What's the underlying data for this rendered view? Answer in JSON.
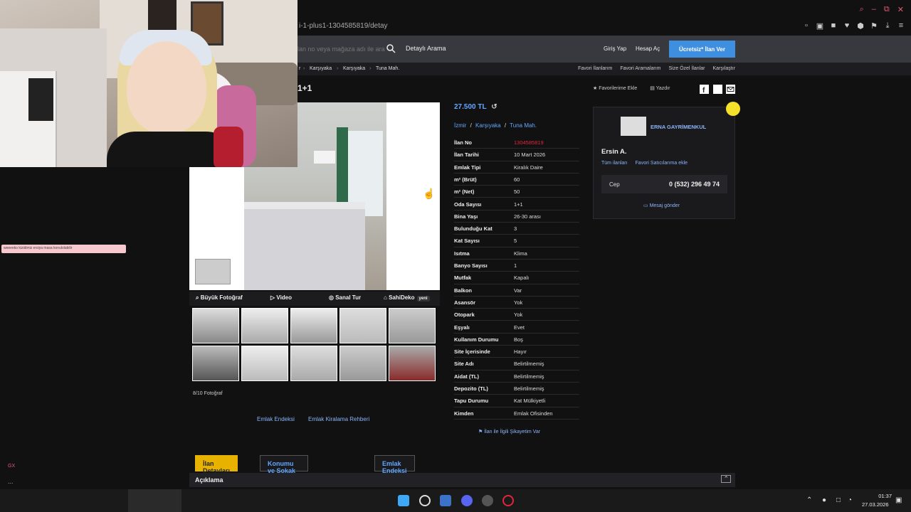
{
  "browser": {
    "url": "i-1-plus1-1304585819/detay",
    "window_controls": [
      "⌕",
      "–",
      "⧉",
      "✕"
    ],
    "toolbar_icons": [
      "▫",
      "▣",
      "■",
      "♥",
      "⬢",
      "⚑",
      "⤓",
      "≡"
    ]
  },
  "site_header": {
    "search_placeholder": "lan no veya mağaza adı ile ara",
    "detailed_search": "Detaylı Arama",
    "login": "Giriş Yap",
    "register": "Hesap Aç",
    "post_ad": "Ücretsiz* İlan Ver"
  },
  "breadcrumb": {
    "items": [
      "r",
      "Karşıyaka",
      "Karşıyaka",
      "Tuna Mah."
    ],
    "links": [
      "Favori İlanlarım",
      "Favori Aramalarım",
      "Size Özel İlanlar",
      "Karşılaştır"
    ]
  },
  "listing": {
    "title": "1+1",
    "favorite": "Favorilerime Ekle",
    "print": "Yazdır",
    "price": "27.500 TL",
    "location": [
      "İzmir",
      "Karşıyaka",
      "Tuna Mah."
    ],
    "location_sep": "/",
    "details": [
      {
        "key": "İlan No",
        "value": "1304585819",
        "highlight": true
      },
      {
        "key": "İlan Tarihi",
        "value": "10 Mart 2026"
      },
      {
        "key": "Emlak Tipi",
        "value": "Kiralık Daire"
      },
      {
        "key": "m² (Brüt)",
        "value": "60"
      },
      {
        "key": "m² (Net)",
        "value": "50"
      },
      {
        "key": "Oda Sayısı",
        "value": "1+1"
      },
      {
        "key": "Bina Yaşı",
        "value": "26-30 arası"
      },
      {
        "key": "Bulunduğu Kat",
        "value": "3"
      },
      {
        "key": "Kat Sayısı",
        "value": "5"
      },
      {
        "key": "Isıtma",
        "value": "Klima"
      },
      {
        "key": "Banyo Sayısı",
        "value": "1"
      },
      {
        "key": "Mutfak",
        "value": "Kapalı"
      },
      {
        "key": "Balkon",
        "value": "Var"
      },
      {
        "key": "Asansör",
        "value": "Yok"
      },
      {
        "key": "Otopark",
        "value": "Yok"
      },
      {
        "key": "Eşyalı",
        "value": "Evet"
      },
      {
        "key": "Kullanım Durumu",
        "value": "Boş"
      },
      {
        "key": "Site İçerisinde",
        "value": "Hayır"
      },
      {
        "key": "Site Adı",
        "value": "Belirtilmemiş"
      },
      {
        "key": "Aidat (TL)",
        "value": "Belirtilmemiş"
      },
      {
        "key": "Depozito (TL)",
        "value": "Belirtilmemiş"
      },
      {
        "key": "Tapu Durumu",
        "value": "Kat Mülkiyetli"
      },
      {
        "key": "Kimden",
        "value": "Emlak Ofisinden"
      }
    ],
    "complaint": "İlan ile İlgili Şikayetim Var"
  },
  "photos": {
    "tabs": [
      "Büyük Fotoğraf",
      "Video",
      "Sanal Tur",
      "SahiDeko"
    ],
    "new_badge": "yeni",
    "count": "8/10 Fotoğraf",
    "watermark": "sahibinden.com"
  },
  "extra_links": [
    "Emlak Endeksi",
    "Emlak Kiralama Rehberi"
  ],
  "seller": {
    "company": "ERNA GAYRİMENKUL",
    "agent": "Ersin A.",
    "all_ads": "Tüm ilanları",
    "add_fav": "Favori Satıcılarıma ekle",
    "phone_label": "Cep",
    "phone": "0 (532) 296 49 74",
    "message": "Mesaj gönder"
  },
  "bottom_tabs": [
    "İlan Detayları",
    "Konumu ve Sokak Görünümü",
    "Emlak Endeksi"
  ],
  "description_label": "Açıklama",
  "overlay": {
    "banner": "weeeeko kizidimiz ersiya masa konulolabilir",
    "gx": "GX",
    "dots": "..."
  },
  "taskbar": {
    "time": "01:37",
    "date": "27.03.2026",
    "tray_icons": [
      "⌃",
      "●",
      "☵",
      "□",
      "◔",
      "▣"
    ]
  },
  "colors": {
    "accent": "#62a7ff",
    "cta": "#3f8fe0",
    "active_tab": "#e7b300",
    "highlight_text": "#e0263a"
  }
}
